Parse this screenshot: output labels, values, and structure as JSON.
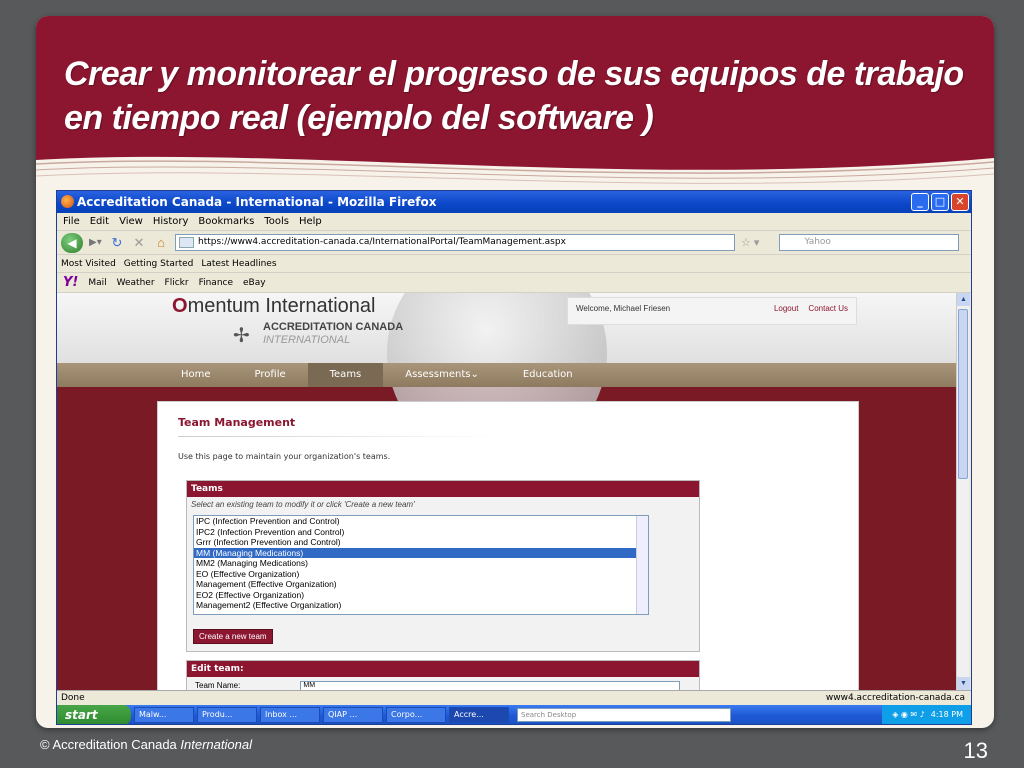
{
  "slide": {
    "title": "Crear y monitorear el progreso de sus equipos  de trabajo en tiempo real (ejemplo del software )",
    "footer_prefix": "© Accreditation Canada",
    "footer_italic": "International",
    "page_number": "13"
  },
  "browser": {
    "window_title": "Accreditation Canada - International - Mozilla Firefox",
    "menu": [
      "File",
      "Edit",
      "View",
      "History",
      "Bookmarks",
      "Tools",
      "Help"
    ],
    "url": "https://www4.accreditation-canada.ca/InternationalPortal/TeamManagement.aspx",
    "search_placeholder": "Yahoo",
    "bookmarks": [
      "Most Visited",
      "Getting Started",
      "Latest Headlines"
    ],
    "ytoolbar": [
      "Y!",
      "Mail",
      "Weather",
      "Flickr",
      "Finance",
      "eBay"
    ],
    "status_left": "Done",
    "status_right": "www4.accreditation-canada.ca"
  },
  "site": {
    "logo_main_first": "O",
    "logo_main_rest": "mentum International",
    "logo_sub1": "ACCREDITATION CANADA",
    "logo_sub2": "INTERNATIONAL",
    "welcome": "Welcome, Michael Friesen",
    "logout": "Logout",
    "contact": "Contact Us",
    "nav": [
      "Home",
      "Profile",
      "Teams",
      "Assessments⌄",
      "Education"
    ],
    "active_nav": "Teams"
  },
  "team_page": {
    "heading": "Team Management",
    "intro": "Use this page to maintain your organization's teams.",
    "teams_header": "Teams",
    "teams_hint": "Select an existing team to modify it or click 'Create a new team'",
    "teams": [
      "IPC (Infection Prevention and Control)",
      "IPC2 (Infection Prevention and Control)",
      "Grrr (Infection Prevention and Control)",
      "MM (Managing Medications)",
      "MM2 (Managing Medications)",
      "EO (Effective Organization)",
      "Management (Effective Organization)",
      "EO2 (Effective Organization)",
      "Management2 (Effective Organization)"
    ],
    "selected_team": "MM (Managing Medications)",
    "create_button": "Create a new team",
    "edit_header": "Edit team:",
    "team_name_label": "Team Name:",
    "team_name_value": "MM"
  },
  "taskbar": {
    "start": "start",
    "items": [
      "Malw...",
      "Produ...",
      "Inbox ...",
      "QIAP ...",
      "Corpo...",
      "Accre..."
    ],
    "search_placeholder": "Search Desktop",
    "clock": "4:18 PM"
  },
  "colors": {
    "brand_maroon": "#8c1530",
    "xp_blue": "#0a46c8",
    "selection": "#316ac5"
  }
}
